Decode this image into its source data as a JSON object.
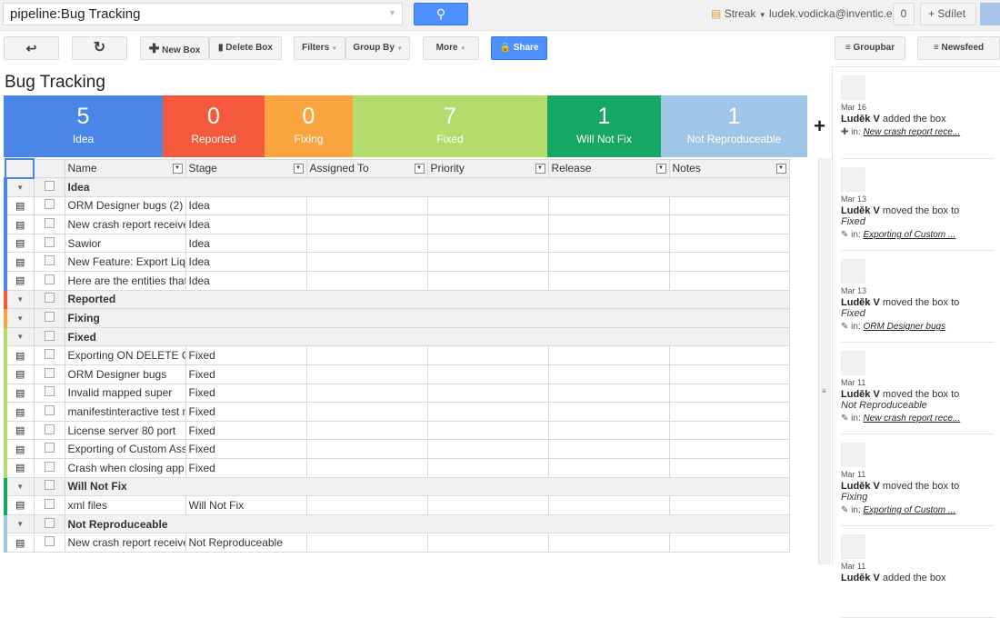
{
  "topbar": {
    "search_value": "pipeline:Bug Tracking",
    "streak_label": "Streak",
    "user_email": "ludek.vodicka@inventic.eu",
    "count": "0",
    "share_label": "Sdílet"
  },
  "toolbar": {
    "back_icon": "↩",
    "refresh_icon": "↻",
    "new_box": "New Box",
    "delete_box": "Delete Box",
    "filters": "Filters",
    "group_by": "Group By",
    "more": "More",
    "share": "Share",
    "groupbar": "Groupbar",
    "newsfeed": "Newsfeed"
  },
  "page_title": "Bug Tracking",
  "stages": [
    {
      "count": "5",
      "label": "Idea",
      "color": "#4a86e8"
    },
    {
      "count": "0",
      "label": "Reported",
      "color": "#f4593b"
    },
    {
      "count": "0",
      "label": "Fixing",
      "color": "#f9a43f"
    },
    {
      "count": "7",
      "label": "Fixed",
      "color": "#b3dc6c"
    },
    {
      "count": "1",
      "label": "Will Not Fix",
      "color": "#16a765"
    },
    {
      "count": "1",
      "label": "Not Reproduceable",
      "color": "#9fc6e7"
    }
  ],
  "add_stage": "+",
  "columns": [
    "Name",
    "Stage",
    "Assigned To",
    "Priority",
    "Release",
    "Notes"
  ],
  "groups": [
    {
      "name": "Idea",
      "rows": [
        [
          "ORM Designer bugs (2)",
          "Idea"
        ],
        [
          "New crash report received",
          "Idea"
        ],
        [
          "Sawior",
          "Idea"
        ],
        [
          "New Feature: Export Liquibase",
          "Idea"
        ],
        [
          "Here are the entities that I",
          "Idea"
        ]
      ]
    },
    {
      "name": "Reported",
      "rows": []
    },
    {
      "name": "Fixing",
      "rows": []
    },
    {
      "name": "Fixed",
      "rows": [
        [
          "Exporting ON DELETE CASCADE",
          "Fixed"
        ],
        [
          "ORM Designer bugs",
          "Fixed"
        ],
        [
          "Invalid mapped super",
          "Fixed"
        ],
        [
          "manifestinteractive test model",
          "Fixed"
        ],
        [
          "License server 80 port",
          "Fixed"
        ],
        [
          "Exporting of Custom Associations",
          "Fixed"
        ],
        [
          "Crash when closing app with",
          "Fixed"
        ]
      ]
    },
    {
      "name": "Will Not Fix",
      "rows": [
        [
          "xml files",
          "Will Not Fix"
        ]
      ]
    },
    {
      "name": "Not Reproduceable",
      "rows": [
        [
          "New crash report received",
          "Not Reproduceable"
        ]
      ]
    }
  ],
  "newsfeed": [
    {
      "date": "Mar 16",
      "user": "Luděk V",
      "action": "added the box",
      "stage": "",
      "icon": "plus-icon",
      "in": "in:",
      "link": "New crash report rece..."
    },
    {
      "date": "Mar 13",
      "user": "Luděk V",
      "action": "moved the box to",
      "stage": "Fixed",
      "icon": "pencil-icon",
      "in": "in:",
      "link": "Exporting of Custom ..."
    },
    {
      "date": "Mar 13",
      "user": "Luděk V",
      "action": "moved the box to",
      "stage": "Fixed",
      "icon": "pencil-icon",
      "in": "in:",
      "link": "ORM Designer bugs"
    },
    {
      "date": "Mar 11",
      "user": "Luděk V",
      "action": "moved the box to",
      "stage": "Not Reproduceable",
      "icon": "pencil-icon",
      "in": "in:",
      "link": "New crash report rece..."
    },
    {
      "date": "Mar 11",
      "user": "Luděk V",
      "action": "moved the box to",
      "stage": "Fixing",
      "icon": "pencil-icon",
      "in": "in:",
      "link": "Exporting of Custom ..."
    },
    {
      "date": "Mar 11",
      "user": "Luděk V",
      "action": "added the box",
      "stage": "",
      "icon": "plus-icon",
      "in": "",
      "link": ""
    }
  ]
}
